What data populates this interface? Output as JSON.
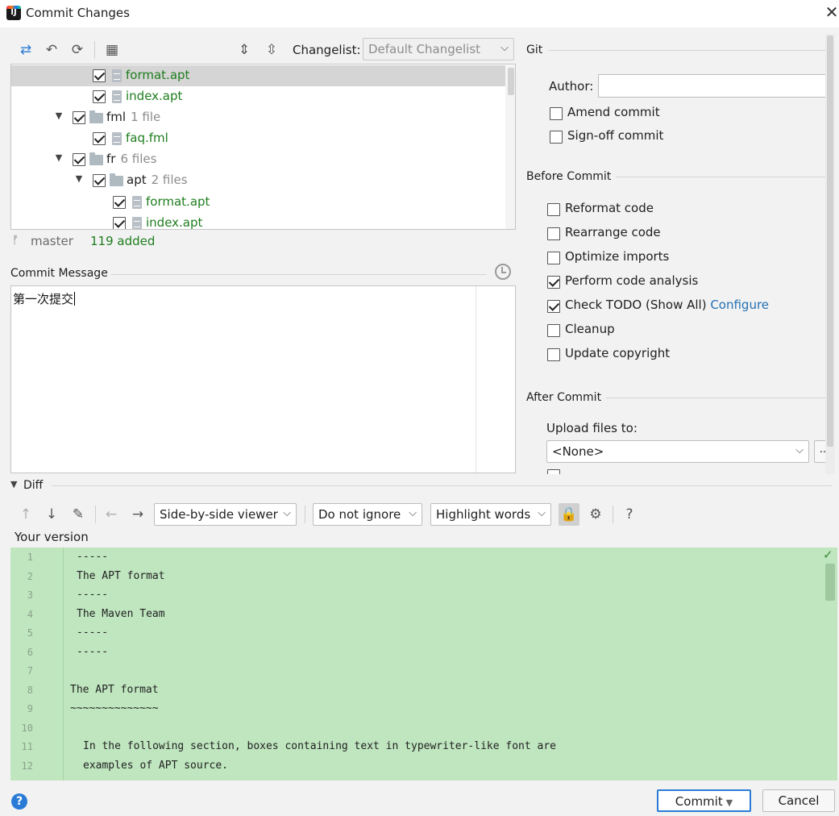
{
  "window": {
    "title": "Commit Changes",
    "app_icon": "intellij-logo",
    "close": "✕"
  },
  "toolbar": {
    "icons": [
      "diff-arrows-icon",
      "rollback-icon",
      "refresh-icon",
      "group-by-icon",
      "expand-all-icon",
      "collapse-all-icon"
    ],
    "changelist_label": "Changelist:",
    "changelist_value": "Default Changelist"
  },
  "tree": {
    "rows": [
      {
        "name": "format.apt",
        "count": "",
        "type": "file",
        "checked": true,
        "selected": true,
        "green": true
      },
      {
        "name": "index.apt",
        "count": "",
        "type": "file",
        "checked": true,
        "selected": false,
        "green": true
      },
      {
        "name": "fml",
        "count": "1 file",
        "type": "folder",
        "checked": true,
        "selected": false,
        "green": false
      },
      {
        "name": "faq.fml",
        "count": "",
        "type": "file",
        "checked": true,
        "selected": false,
        "green": true
      },
      {
        "name": "fr",
        "count": "6 files",
        "type": "folder",
        "checked": true,
        "selected": false,
        "green": false
      },
      {
        "name": "apt",
        "count": "2 files",
        "type": "folder",
        "checked": true,
        "selected": false,
        "green": false
      },
      {
        "name": "format.apt",
        "count": "",
        "type": "file",
        "checked": true,
        "selected": false,
        "green": true
      },
      {
        "name": "index.apt",
        "count": "",
        "type": "file",
        "checked": true,
        "selected": false,
        "green": true
      }
    ]
  },
  "status": {
    "branch": "master",
    "added": "119 added"
  },
  "commit_message": {
    "label": "Commit Message",
    "text": "第一次提交"
  },
  "git": {
    "title": "Git",
    "author_label": "Author:",
    "author_value": "",
    "amend": {
      "label": "Amend commit",
      "checked": false
    },
    "signoff": {
      "label": "Sign-off commit",
      "checked": false
    }
  },
  "before_commit": {
    "title": "Before Commit",
    "options": [
      {
        "label": "Reformat code",
        "checked": false
      },
      {
        "label": "Rearrange code",
        "checked": false
      },
      {
        "label": "Optimize imports",
        "checked": false
      },
      {
        "label": "Perform code analysis",
        "checked": true
      },
      {
        "label": "Check TODO (Show All)",
        "checked": true,
        "link": "Configure"
      },
      {
        "label": "Cleanup",
        "checked": false
      },
      {
        "label": "Update copyright",
        "checked": false
      }
    ]
  },
  "after_commit": {
    "title": "After Commit",
    "upload_label": "Upload files to:",
    "upload_value": "<None>",
    "more": "..."
  },
  "diff": {
    "label": "Diff",
    "viewer": "Side-by-side viewer",
    "ignore": "Do not ignore",
    "highlight": "Highlight words",
    "your_version": "Your version",
    "lines": [
      {
        "n": "1",
        "text": "-----",
        "indent": 1
      },
      {
        "n": "2",
        "text": "The APT format",
        "indent": 1
      },
      {
        "n": "3",
        "text": "-----",
        "indent": 1
      },
      {
        "n": "4",
        "text": "The Maven Team",
        "indent": 1
      },
      {
        "n": "5",
        "text": "-----",
        "indent": 1
      },
      {
        "n": "6",
        "text": "-----",
        "indent": 1
      },
      {
        "n": "7",
        "text": "",
        "indent": 0
      },
      {
        "n": "8",
        "text": "The APT format",
        "indent": 0
      },
      {
        "n": "9",
        "text": "~~~~~~~~~~~~~~",
        "indent": 0
      },
      {
        "n": "10",
        "text": "",
        "indent": 0
      },
      {
        "n": "11",
        "text": "In the following section, boxes containing text in typewriter-like font are",
        "indent": 2
      },
      {
        "n": "12",
        "text": "examples of APT source.",
        "indent": 2
      }
    ]
  },
  "buttons": {
    "commit": "Commit",
    "cancel": "Cancel",
    "help": "?"
  }
}
